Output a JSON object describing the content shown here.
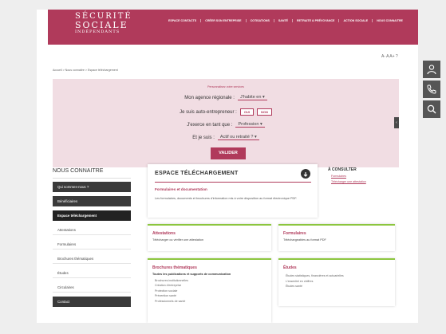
{
  "logo": {
    "line1": "SÉCURITÉ",
    "line2": "SOCIALE",
    "line3": "INDÉPENDANTS"
  },
  "nav": [
    "ESPACE CONTACTS",
    "CRÉER SON ENTREPRISE",
    "COTISATIONS",
    "SANTÉ",
    "RETRAITE & PRÉVOYANCE",
    "ACTION SOCIALE",
    "NOUS CONNAITRE"
  ],
  "tools": "A- A A+ ?",
  "breadcrumb": "Accueil > Nous connaitre > Espace téléchargement",
  "finder": {
    "hint": "Personnalisez votre services",
    "agency_label": "Mon agence régionale :",
    "agency_value": "J'habite en",
    "auto_label": "Je suis auto-entrepreneur :",
    "yes": "OUI",
    "no": "NON",
    "profession_label": "J'exerce en tant que :",
    "profession_value": "Profession",
    "status_label": "Et je suis :",
    "status_value": "Actif ou retraité ?",
    "submit": "VALIDER"
  },
  "sidebar": {
    "title": "NOUS CONNAITRE",
    "items": [
      {
        "label": "Qui sommes-nous ?",
        "style": "dark"
      },
      {
        "label": "Bénéficiaires",
        "style": "dark"
      },
      {
        "label": "Espace téléchargement",
        "style": "active"
      },
      {
        "label": "Attestations",
        "style": "light"
      },
      {
        "label": "Formulaires",
        "style": "light"
      },
      {
        "label": "Brochures thématiques",
        "style": "light"
      },
      {
        "label": "Études",
        "style": "light"
      },
      {
        "label": "Circulaires",
        "style": "light"
      },
      {
        "label": "Contact",
        "style": "dark"
      }
    ]
  },
  "main": {
    "title": "ESPACE TÉLÉCHARGEMENT",
    "subtitle": "Formulaires et documentation",
    "description": "Les formulaires, documents et brochures d'information mis à votre disposition au format électronique PDF."
  },
  "aside": {
    "title": "À CONSULTER",
    "links": [
      "Formulaires",
      "Télécharger une attestation"
    ]
  },
  "cards": {
    "attestations": {
      "title": "Attestations",
      "desc": "Télécharger ou vérifier une attestation"
    },
    "formulaires": {
      "title": "Formulaires",
      "desc": "Téléchargeables au format PDF"
    },
    "brochures": {
      "title": "Brochures thématiques",
      "desc": "Toutes les publications et supports de communication",
      "items": [
        "Brochures institutionnelles",
        "Création d'entreprise",
        "Protection sociale",
        "Prévention santé",
        "Professionnels de santé"
      ]
    },
    "etudes": {
      "title": "Études",
      "items": [
        "Études statistiques, financières et actuarielles",
        "L'essentiel en chiffres",
        "Études santé"
      ]
    }
  },
  "colors": {
    "brand": "#b03a5b",
    "accent": "#8cc63f",
    "dark": "#3a3a3a"
  },
  "icons": [
    "user-icon",
    "phone-icon",
    "search-icon",
    "download-icon"
  ]
}
